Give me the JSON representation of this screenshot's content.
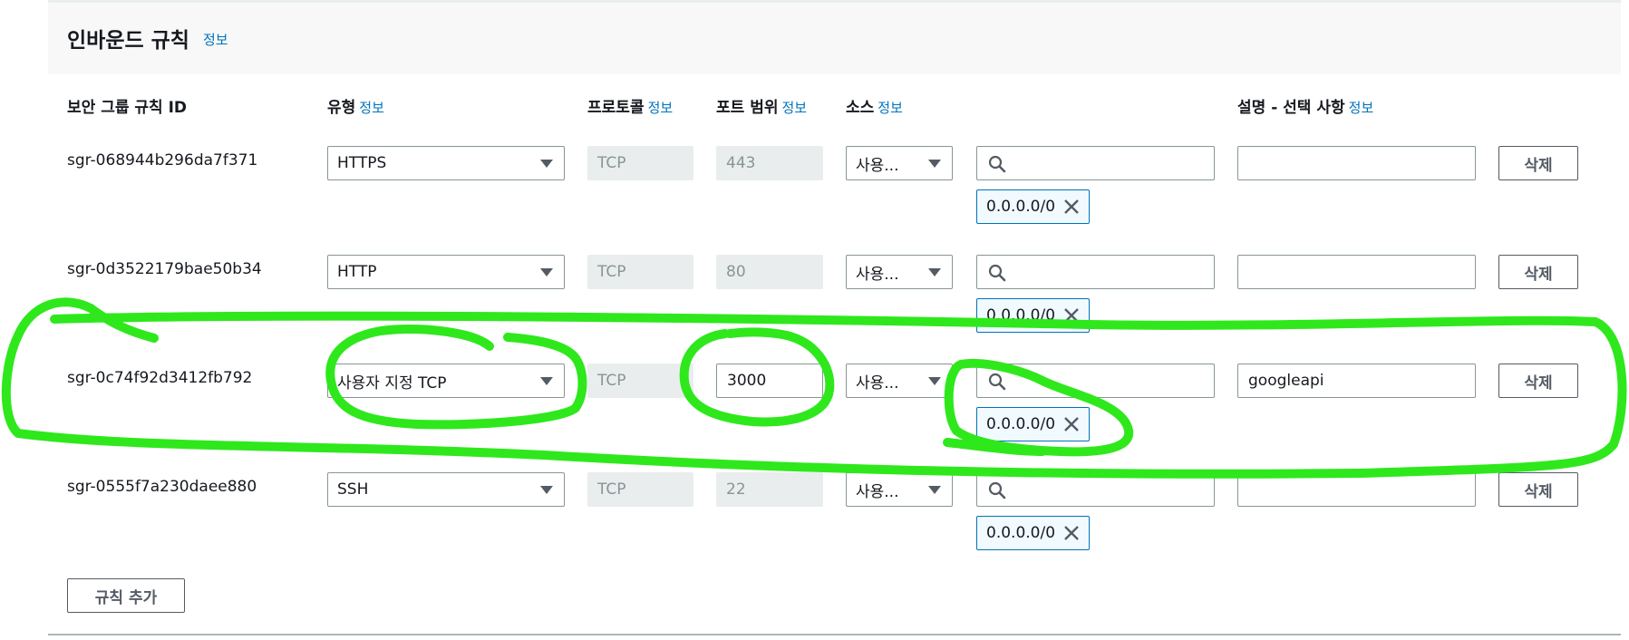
{
  "panel": {
    "title": "인바운드 규칙",
    "info_label": "정보"
  },
  "columns": {
    "rule_id": "보안 그룹 규칙 ID",
    "type": "유형",
    "protocol": "프로토콜",
    "port_range": "포트 범위",
    "source": "소스",
    "description": "설명 - 선택 사항",
    "info_label": "정보"
  },
  "rows": [
    {
      "id": "sgr-068944b296da7f371",
      "type": "HTTPS",
      "protocol": "TCP",
      "port": "443",
      "source": "사용...",
      "cidr": "0.0.0.0/0",
      "description": "",
      "delete_label": "삭제"
    },
    {
      "id": "sgr-0d3522179bae50b34",
      "type": "HTTP",
      "protocol": "TCP",
      "port": "80",
      "source": "사용...",
      "cidr": "0.0.0.0/0",
      "description": "",
      "delete_label": "삭제"
    },
    {
      "id": "sgr-0c74f92d3412fb792",
      "type": "사용자 지정 TCP",
      "protocol": "TCP",
      "port": "3000",
      "source": "사용...",
      "cidr": "0.0.0.0/0",
      "description": "googleapi",
      "delete_label": "삭제"
    },
    {
      "id": "sgr-0555f7a230daee880",
      "type": "SSH",
      "protocol": "TCP",
      "port": "22",
      "source": "사용...",
      "cidr": "0.0.0.0/0",
      "description": "",
      "delete_label": "삭제"
    }
  ],
  "add_rule_label": "규칙 추가",
  "colors": {
    "link": "#0073bb",
    "annotation": "#2ee81c",
    "token_border": "#0073bb",
    "disabled_bg": "#eaeded"
  },
  "icons": [
    "search-icon",
    "chevron-down-icon",
    "close-icon"
  ]
}
